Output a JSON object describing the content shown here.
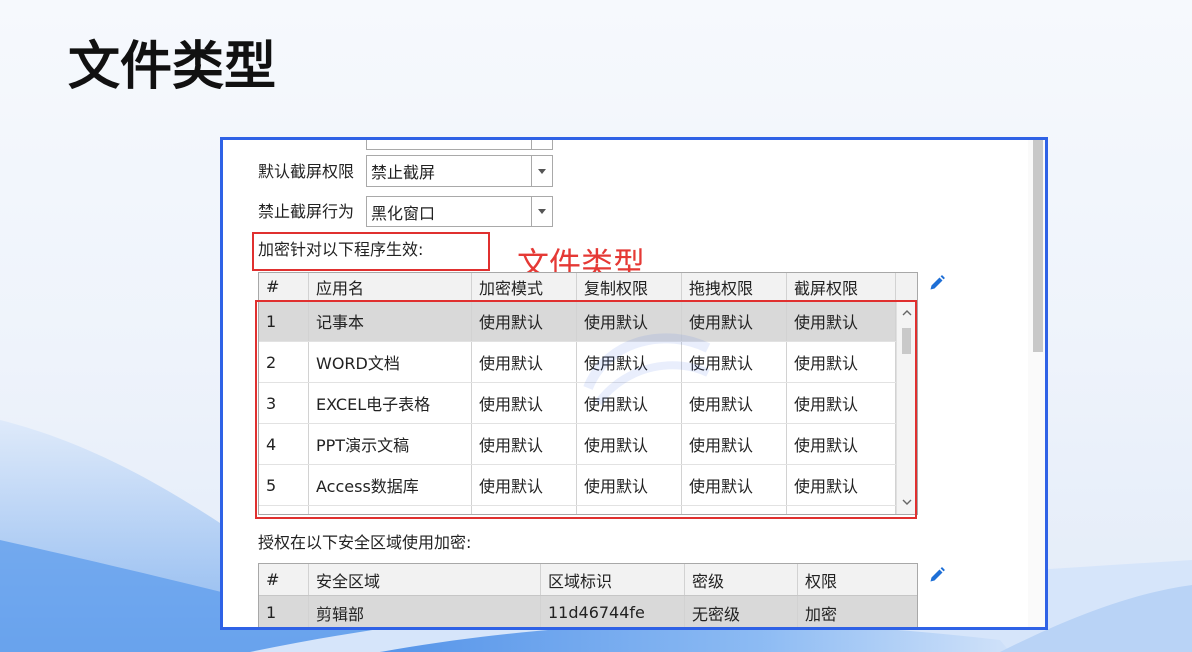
{
  "slide": {
    "title": "文件类型"
  },
  "colors": {
    "frame_border": "#2f62e6",
    "annotation_red": "#e53935",
    "highlight_box": "#e0302f",
    "edit_icon": "#1e6fd6",
    "selected_row": "#d9d9d9"
  },
  "settings": {
    "screenshot_permission": {
      "label": "默认截屏权限",
      "value": "禁止截屏"
    },
    "screenshot_behavior": {
      "label": "禁止截屏行为",
      "value": "黑化窗口"
    }
  },
  "programs": {
    "label": "加密针对以下程序生效:",
    "annotation": "文件类型",
    "edit_icon": "pencil-icon",
    "columns": [
      "#",
      "应用名",
      "加密模式",
      "复制权限",
      "拖拽权限",
      "截屏权限"
    ],
    "rows": [
      [
        "1",
        "记事本",
        "使用默认",
        "使用默认",
        "使用默认",
        "使用默认"
      ],
      [
        "2",
        "WORD文档",
        "使用默认",
        "使用默认",
        "使用默认",
        "使用默认"
      ],
      [
        "3",
        "EXCEL电子表格",
        "使用默认",
        "使用默认",
        "使用默认",
        "使用默认"
      ],
      [
        "4",
        "PPT演示文稿",
        "使用默认",
        "使用默认",
        "使用默认",
        "使用默认"
      ],
      [
        "5",
        "Access数据库",
        "使用默认",
        "使用默认",
        "使用默认",
        "使用默认"
      ]
    ]
  },
  "zones": {
    "label": "授权在以下安全区域使用加密:",
    "edit_icon": "pencil-icon",
    "columns": [
      "#",
      "安全区域",
      "区域标识",
      "密级",
      "权限"
    ],
    "rows": [
      [
        "1",
        "剪辑部",
        "11d46744fe",
        "无密级",
        "加密"
      ]
    ]
  }
}
